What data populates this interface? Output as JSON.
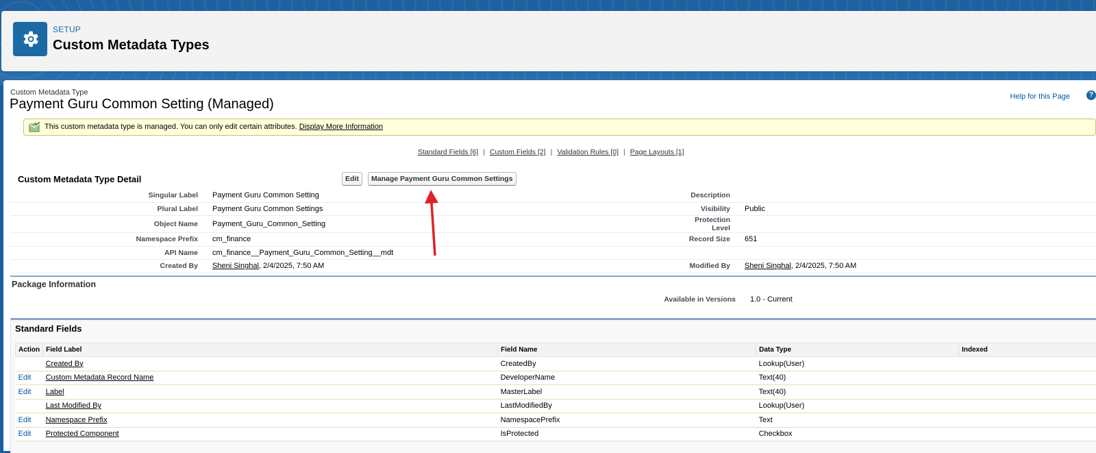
{
  "header": {
    "kicker": "SETUP",
    "title": "Custom Metadata Types",
    "icon": "gear-icon"
  },
  "page": {
    "type_label": "Custom Metadata Type",
    "title": "Payment Guru Common Setting (Managed)",
    "help_link": "Help for this Page",
    "help_icon": "?"
  },
  "banner": {
    "message": "This custom metadata type is managed. You can only edit certain attributes.",
    "link": "Display More Information",
    "icon": "managed-package-icon"
  },
  "related_links": [
    "Standard Fields [6]",
    "Custom Fields [2]",
    "Validation Rules [0]",
    "Page Layouts [1]"
  ],
  "related_separator": "|",
  "detail": {
    "section_title": "Custom Metadata Type Detail",
    "edit_button": "Edit",
    "manage_button": "Manage Payment Guru Common Settings",
    "rows": [
      {
        "l1": "Singular Label",
        "v1": "Payment Guru Common Setting",
        "l2": "Description",
        "v2": ""
      },
      {
        "l1": "Plural Label",
        "v1": "Payment Guru Common Settings",
        "l2": "Visibility",
        "v2": "Public"
      },
      {
        "l1": "Object Name",
        "v1": "Payment_Guru_Common_Setting",
        "l2": "Protection Level",
        "v2": ""
      },
      {
        "l1": "Namespace Prefix",
        "v1": "cm_finance",
        "l2": "Record Size",
        "v2": "651"
      },
      {
        "l1": "API Name",
        "v1": "cm_finance__Payment_Guru_Common_Setting__mdt",
        "l2": "",
        "v2": ""
      }
    ],
    "created_by_label": "Created By",
    "created_by_user": "Sheni Singhal",
    "created_by_date": ", 2/4/2025, 7:50 AM",
    "modified_by_label": "Modified By",
    "modified_by_user": "Sheni Singhal",
    "modified_by_date": ", 2/4/2025, 7:50 AM"
  },
  "package": {
    "title": "Package Information",
    "versions_label": "Available in Versions",
    "versions_value": "1.0 - Current"
  },
  "standard_fields": {
    "title": "Standard Fields",
    "columns": [
      "Action",
      "Field Label",
      "Field Name",
      "Data Type",
      "Indexed"
    ],
    "rows": [
      {
        "action": "",
        "label": "Created By",
        "name": "CreatedBy",
        "type": "Lookup(User)",
        "indexed": ""
      },
      {
        "action": "Edit",
        "label": "Custom Metadata Record Name",
        "name": "DeveloperName",
        "type": "Text(40)",
        "indexed": ""
      },
      {
        "action": "Edit",
        "label": "Label",
        "name": "MasterLabel",
        "type": "Text(40)",
        "indexed": ""
      },
      {
        "action": "",
        "label": "Last Modified By",
        "name": "LastModifiedBy",
        "type": "Lookup(User)",
        "indexed": ""
      },
      {
        "action": "Edit",
        "label": "Namespace Prefix",
        "name": "NamespacePrefix",
        "type": "Text",
        "indexed": ""
      },
      {
        "action": "Edit",
        "label": "Protected Component",
        "name": "IsProtected",
        "type": "Checkbox",
        "indexed": ""
      }
    ]
  },
  "annotation": {
    "arrow_color": "#e0202a"
  }
}
